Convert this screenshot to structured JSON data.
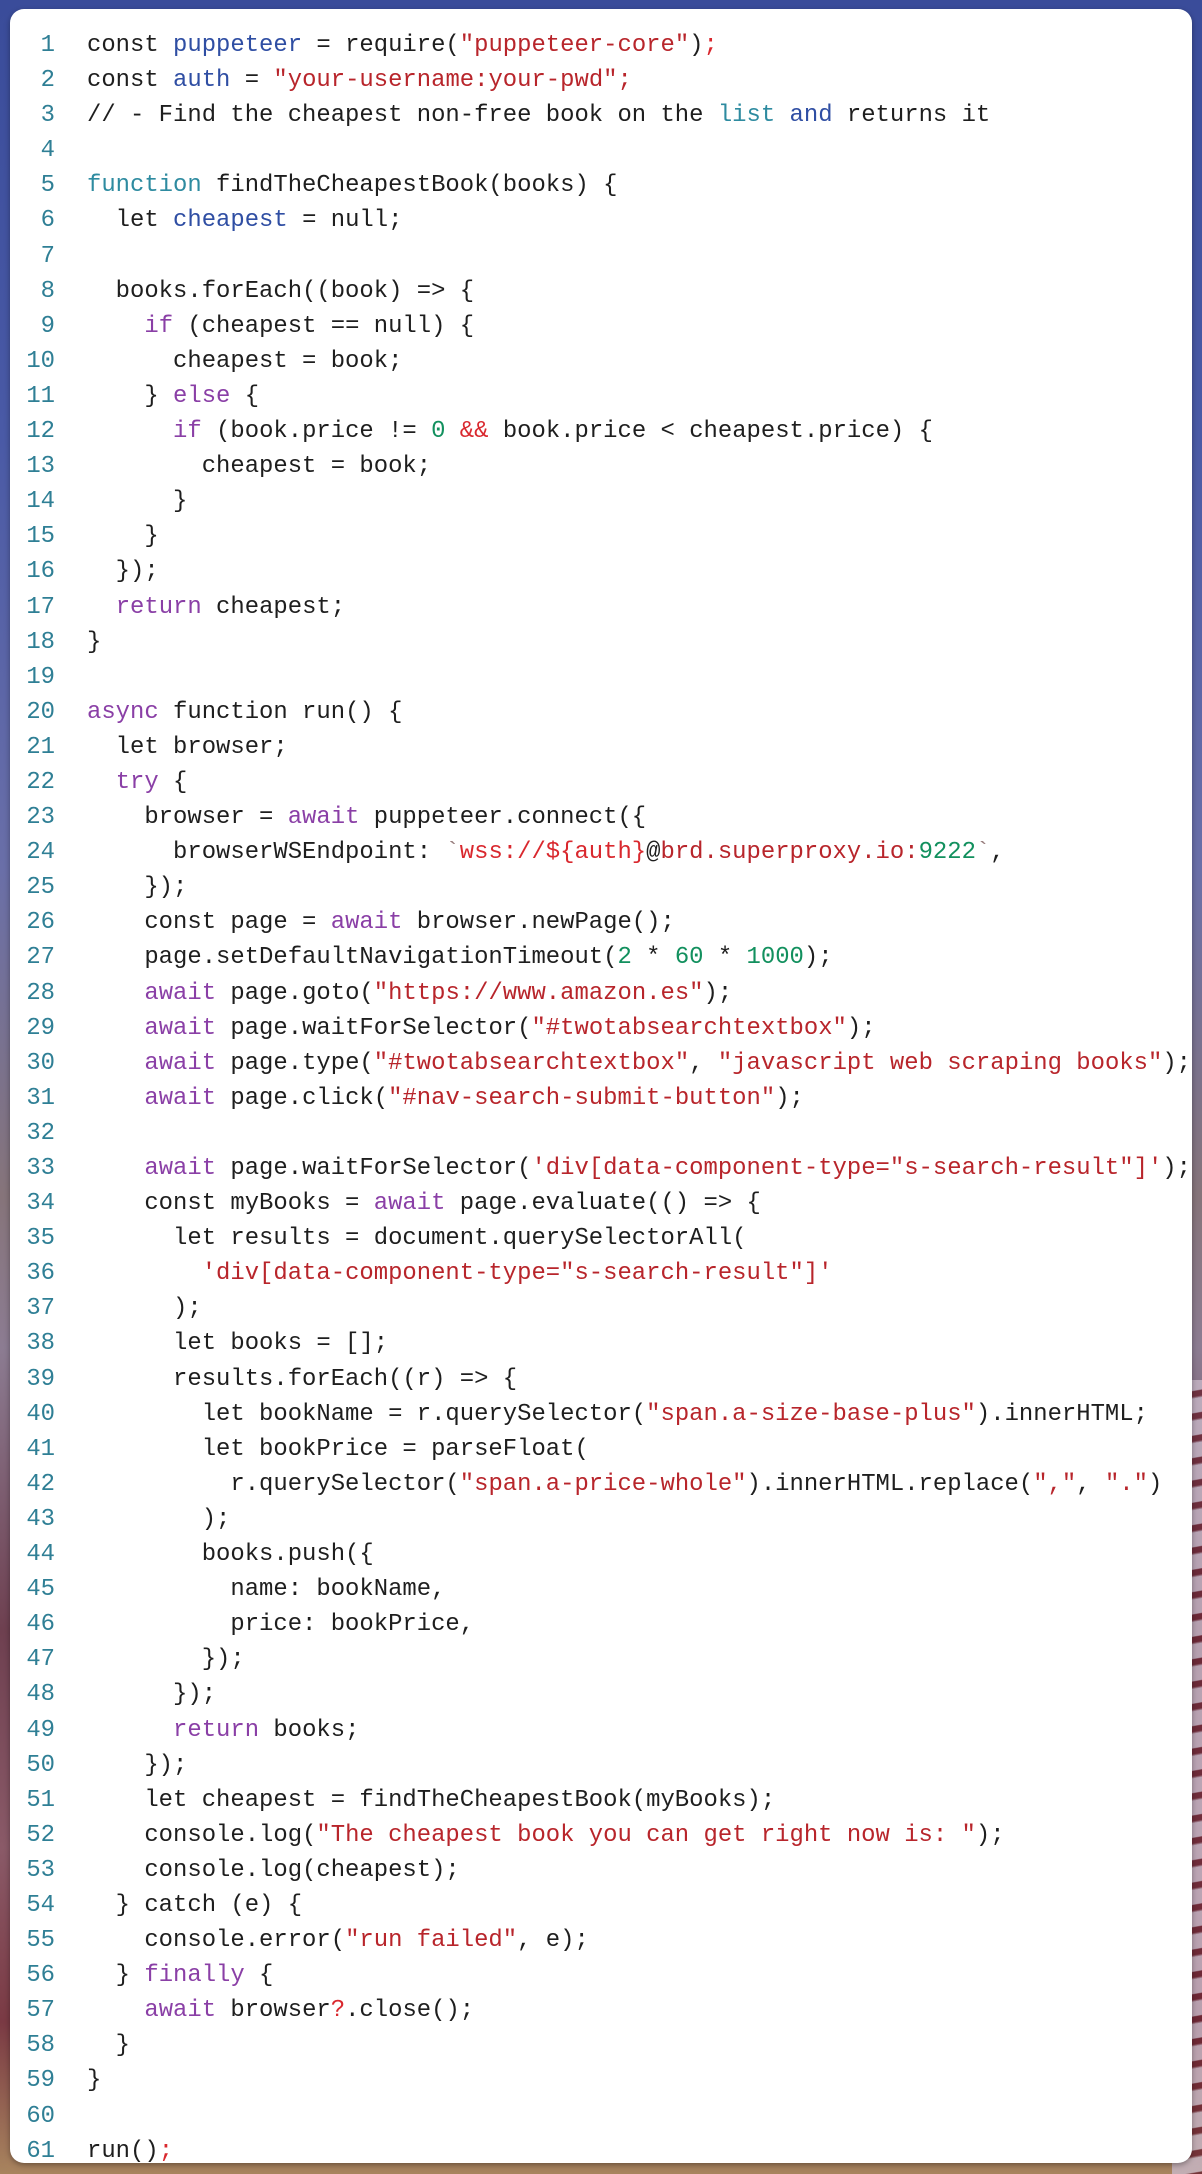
{
  "editor": {
    "language": "javascript",
    "lines": [
      [
        [
          "pl",
          "const "
        ],
        [
          "var",
          "puppeteer"
        ],
        [
          "pl",
          " = require("
        ],
        [
          "str",
          "\"puppeteer-core\""
        ],
        [
          "pl",
          ")"
        ],
        [
          "op",
          ";"
        ]
      ],
      [
        [
          "pl",
          "const "
        ],
        [
          "var",
          "auth"
        ],
        [
          "pl",
          " = "
        ],
        [
          "str",
          "\"your-username:your-pwd\";"
        ]
      ],
      [
        [
          "pl",
          "// - Find the cheapest non-free book on the "
        ],
        [
          "fn",
          "list"
        ],
        [
          "pl",
          " "
        ],
        [
          "var",
          "and"
        ],
        [
          "pl",
          " returns it"
        ]
      ],
      [],
      [
        [
          "fn",
          "function"
        ],
        [
          "pl",
          " findTheCheapestBook(books) {"
        ]
      ],
      [
        [
          "pl",
          "  let "
        ],
        [
          "var",
          "cheapest"
        ],
        [
          "pl",
          " = null;"
        ]
      ],
      [],
      [
        [
          "pl",
          "  books.forEach((book) => {"
        ]
      ],
      [
        [
          "pl",
          "    "
        ],
        [
          "kw",
          "if"
        ],
        [
          "pl",
          " (cheapest == null) {"
        ]
      ],
      [
        [
          "pl",
          "      cheapest = book;"
        ]
      ],
      [
        [
          "pl",
          "    } "
        ],
        [
          "kw",
          "else"
        ],
        [
          "pl",
          " {"
        ]
      ],
      [
        [
          "pl",
          "      "
        ],
        [
          "kw",
          "if"
        ],
        [
          "pl",
          " (book.price != "
        ],
        [
          "num",
          "0"
        ],
        [
          "pl",
          " "
        ],
        [
          "op",
          "&&"
        ],
        [
          "pl",
          " book.price < cheapest.price) {"
        ]
      ],
      [
        [
          "pl",
          "        cheapest = book;"
        ]
      ],
      [
        [
          "pl",
          "      }"
        ]
      ],
      [
        [
          "pl",
          "    }"
        ]
      ],
      [
        [
          "pl",
          "  });"
        ]
      ],
      [
        [
          "pl",
          "  "
        ],
        [
          "kw",
          "return"
        ],
        [
          "pl",
          " cheapest;"
        ]
      ],
      [
        [
          "pl",
          "}"
        ]
      ],
      [],
      [
        [
          "kw",
          "async"
        ],
        [
          "pl",
          " function run() {"
        ]
      ],
      [
        [
          "pl",
          "  let browser;"
        ]
      ],
      [
        [
          "pl",
          "  "
        ],
        [
          "kw",
          "try"
        ],
        [
          "pl",
          " {"
        ]
      ],
      [
        [
          "pl",
          "    browser = "
        ],
        [
          "kw",
          "await"
        ],
        [
          "pl",
          " puppeteer.connect({"
        ]
      ],
      [
        [
          "pl",
          "      browserWSEndpoint: "
        ],
        [
          "tick",
          "`"
        ],
        [
          "op",
          "wss://${auth}"
        ],
        [
          "pl",
          "@"
        ],
        [
          "str",
          "brd.superproxy.io:"
        ],
        [
          "num",
          "9222"
        ],
        [
          "tick",
          "`"
        ],
        [
          "pl",
          ","
        ]
      ],
      [
        [
          "pl",
          "    });"
        ]
      ],
      [
        [
          "pl",
          "    const page = "
        ],
        [
          "kw",
          "await"
        ],
        [
          "pl",
          " browser.newPage();"
        ]
      ],
      [
        [
          "pl",
          "    page.setDefaultNavigationTimeout("
        ],
        [
          "num",
          "2"
        ],
        [
          "pl",
          " * "
        ],
        [
          "num",
          "60"
        ],
        [
          "pl",
          " * "
        ],
        [
          "num",
          "1000"
        ],
        [
          "pl",
          ");"
        ]
      ],
      [
        [
          "pl",
          "    "
        ],
        [
          "kw",
          "await"
        ],
        [
          "pl",
          " page.goto("
        ],
        [
          "str",
          "\"https://www.amazon.es\""
        ],
        [
          "pl",
          ");"
        ]
      ],
      [
        [
          "pl",
          "    "
        ],
        [
          "kw",
          "await"
        ],
        [
          "pl",
          " page.waitForSelector("
        ],
        [
          "str",
          "\"#twotabsearchtextbox\""
        ],
        [
          "pl",
          ");"
        ]
      ],
      [
        [
          "pl",
          "    "
        ],
        [
          "kw",
          "await"
        ],
        [
          "pl",
          " page.type("
        ],
        [
          "str",
          "\"#twotabsearchtextbox\""
        ],
        [
          "pl",
          ", "
        ],
        [
          "str",
          "\"javascript web scraping books\""
        ],
        [
          "pl",
          ");"
        ]
      ],
      [
        [
          "pl",
          "    "
        ],
        [
          "kw",
          "await"
        ],
        [
          "pl",
          " page.click("
        ],
        [
          "str",
          "\"#nav-search-submit-button\""
        ],
        [
          "pl",
          ");"
        ]
      ],
      [],
      [
        [
          "pl",
          "    "
        ],
        [
          "kw",
          "await"
        ],
        [
          "pl",
          " page.waitForSelector("
        ],
        [
          "str",
          "'div[data-component-type=\"s-search-result\"]'"
        ],
        [
          "pl",
          ");"
        ]
      ],
      [
        [
          "pl",
          "    const myBooks = "
        ],
        [
          "kw",
          "await"
        ],
        [
          "pl",
          " page.evaluate(() => {"
        ]
      ],
      [
        [
          "pl",
          "      let results = document.querySelectorAll("
        ]
      ],
      [
        [
          "pl",
          "        "
        ],
        [
          "str",
          "'div[data-component-type=\"s-search-result\"]'"
        ]
      ],
      [
        [
          "pl",
          "      );"
        ]
      ],
      [
        [
          "pl",
          "      let books = [];"
        ]
      ],
      [
        [
          "pl",
          "      results.forEach((r) => {"
        ]
      ],
      [
        [
          "pl",
          "        let bookName = r.querySelector("
        ],
        [
          "str",
          "\"span.a-size-base-plus\""
        ],
        [
          "pl",
          ").innerHTML;"
        ]
      ],
      [
        [
          "pl",
          "        let bookPrice = parseFloat("
        ]
      ],
      [
        [
          "pl",
          "          r.querySelector("
        ],
        [
          "str",
          "\"span.a-price-whole\""
        ],
        [
          "pl",
          ").innerHTML.replace("
        ],
        [
          "str",
          "\",\""
        ],
        [
          "pl",
          ", "
        ],
        [
          "str",
          "\".\""
        ],
        [
          "pl",
          ")"
        ]
      ],
      [
        [
          "pl",
          "        );"
        ]
      ],
      [
        [
          "pl",
          "        books.push({"
        ]
      ],
      [
        [
          "pl",
          "          name: bookName,"
        ]
      ],
      [
        [
          "pl",
          "          price: bookPrice,"
        ]
      ],
      [
        [
          "pl",
          "        });"
        ]
      ],
      [
        [
          "pl",
          "      });"
        ]
      ],
      [
        [
          "pl",
          "      "
        ],
        [
          "kw",
          "return"
        ],
        [
          "pl",
          " books;"
        ]
      ],
      [
        [
          "pl",
          "    });"
        ]
      ],
      [
        [
          "pl",
          "    let cheapest = findTheCheapestBook(myBooks);"
        ]
      ],
      [
        [
          "pl",
          "    console.log("
        ],
        [
          "str",
          "\"The cheapest book you can get right now is: \""
        ],
        [
          "pl",
          ");"
        ]
      ],
      [
        [
          "pl",
          "    console.log(cheapest);"
        ]
      ],
      [
        [
          "pl",
          "  } catch (e) {"
        ]
      ],
      [
        [
          "pl",
          "    console.error("
        ],
        [
          "str",
          "\"run failed\""
        ],
        [
          "pl",
          ", e);"
        ]
      ],
      [
        [
          "pl",
          "  } "
        ],
        [
          "kw",
          "finally"
        ],
        [
          "pl",
          " {"
        ]
      ],
      [
        [
          "pl",
          "    "
        ],
        [
          "kw",
          "await"
        ],
        [
          "pl",
          " browser"
        ],
        [
          "op",
          "?"
        ],
        [
          "pl",
          ".close();"
        ]
      ],
      [
        [
          "pl",
          "  }"
        ]
      ],
      [
        [
          "pl",
          "}"
        ]
      ],
      [],
      [
        [
          "pl",
          "run()"
        ],
        [
          "op",
          ";"
        ]
      ]
    ]
  },
  "colors": {
    "keyword": "#8a3fa6",
    "string": "#b8252b",
    "number": "#12905e",
    "declaration": "#2f4ea3",
    "line_number": "#2f7f95"
  }
}
